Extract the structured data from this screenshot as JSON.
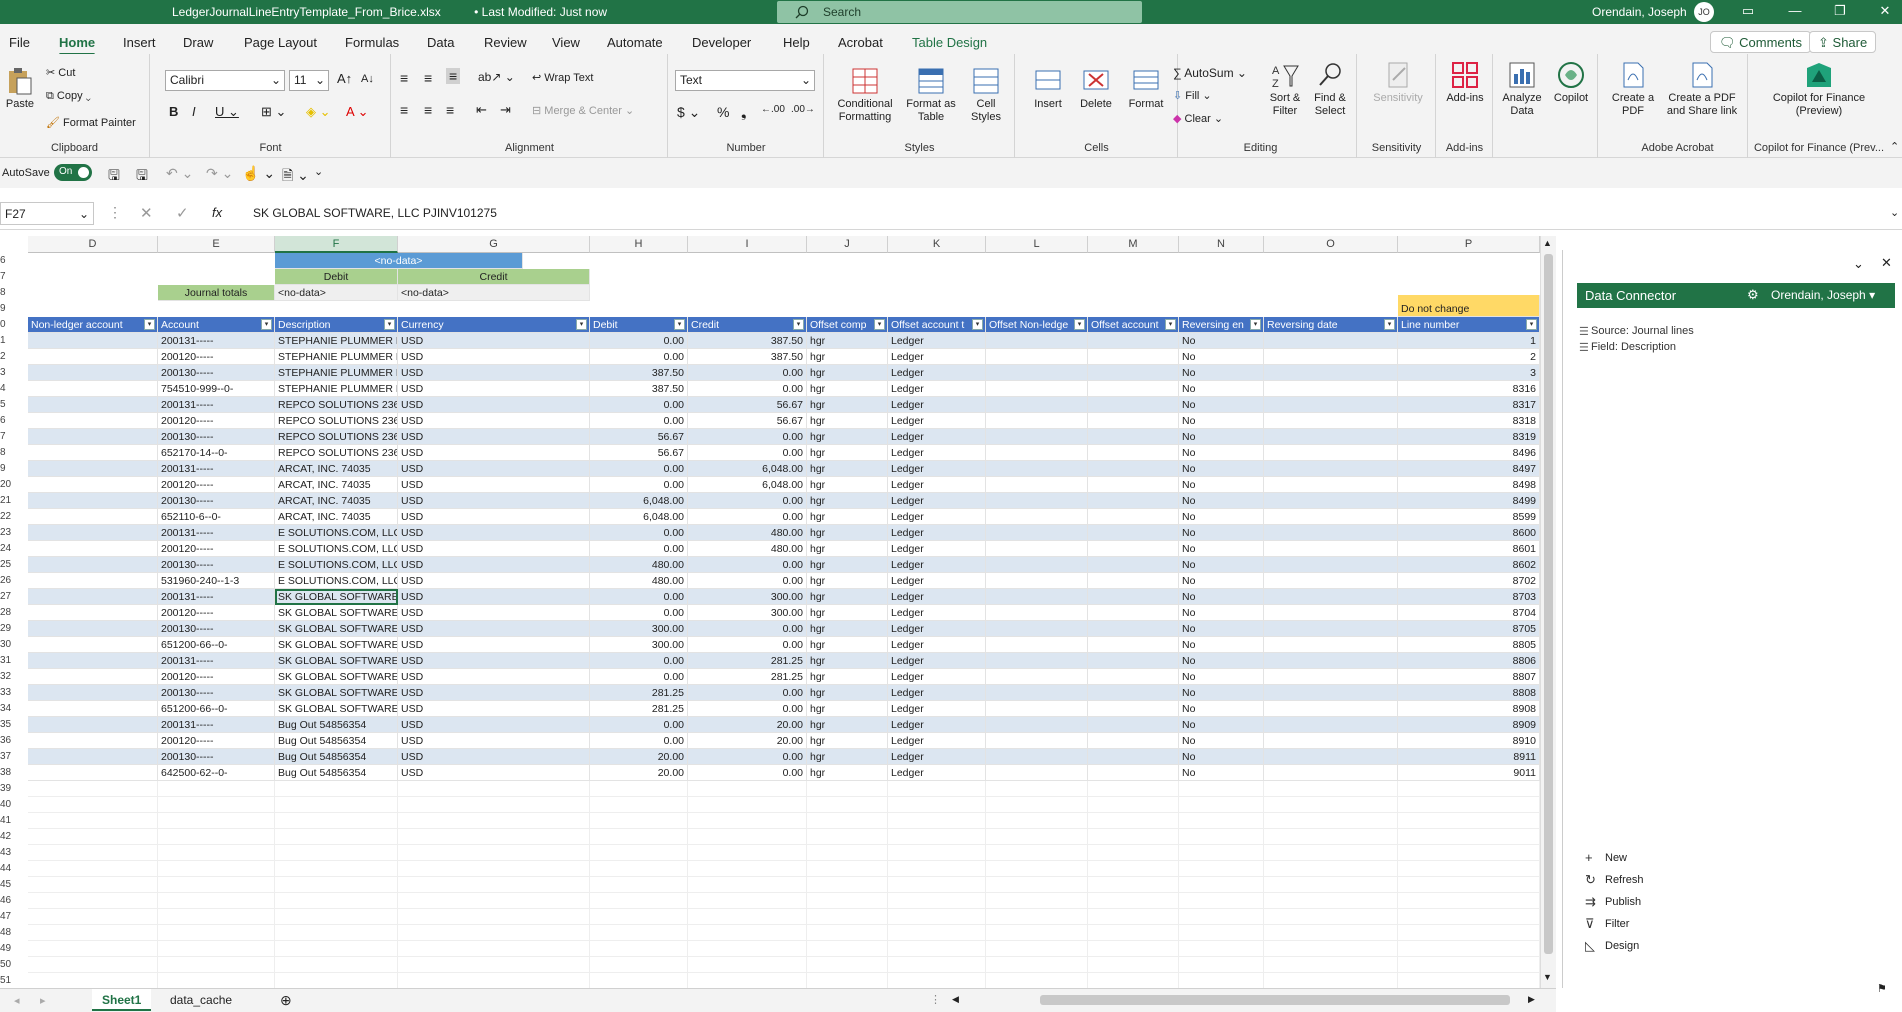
{
  "titlebar": {
    "filename": "LedgerJournalLineEntryTemplate_From_Brice.xlsx",
    "modified": "• Last Modified: Just now",
    "search_placeholder": "Search",
    "user": "Orendain, Joseph",
    "initials": "JO"
  },
  "menu": {
    "tabs": [
      "File",
      "Home",
      "Insert",
      "Draw",
      "Page Layout",
      "Formulas",
      "Data",
      "Review",
      "View",
      "Automate",
      "Developer",
      "Help",
      "Acrobat",
      "Table Design"
    ],
    "comments": "Comments",
    "share": "Share"
  },
  "ribbon": {
    "clipboard": {
      "label": "Clipboard",
      "paste": "Paste",
      "cut": "Cut",
      "copy": "Copy",
      "format_painter": "Format Painter"
    },
    "font": {
      "label": "Font",
      "font_name": "Calibri",
      "font_size": "11"
    },
    "alignment": {
      "label": "Alignment",
      "wrap": "Wrap Text",
      "merge": "Merge & Center"
    },
    "number": {
      "label": "Number",
      "format": "Text"
    },
    "styles": {
      "label": "Styles",
      "conditional": "Conditional Formatting",
      "format_table": "Format as Table",
      "cell_styles": "Cell Styles"
    },
    "cells": {
      "label": "Cells",
      "insert": "Insert",
      "delete": "Delete",
      "format": "Format"
    },
    "editing": {
      "label": "Editing",
      "autosum": "AutoSum",
      "fill": "Fill",
      "clear": "Clear",
      "sort": "Sort & Filter",
      "find": "Find & Select"
    },
    "sensitivity": {
      "label": "Sensitivity",
      "btn": "Sensitivity"
    },
    "addins": {
      "label": "Add-ins",
      "btn": "Add-ins"
    },
    "analyze": {
      "btn": "Analyze Data"
    },
    "copilot": {
      "btn": "Copilot"
    },
    "acrobat": {
      "label": "Adobe Acrobat",
      "create_pdf": "Create a PDF",
      "create_share": "Create a PDF and Share link"
    },
    "copilot_fin": {
      "label": "Copilot for Finance (Prev...",
      "btn": "Copilot for Finance (Preview)"
    }
  },
  "qat": {
    "autosave": "AutoSave",
    "toggle": "On"
  },
  "formula_bar": {
    "name_box": "F27",
    "fx": "fx",
    "formula": "SK GLOBAL SOFTWARE, LLC PJINV101275"
  },
  "columns": [
    "D",
    "E",
    "F",
    "G",
    "H",
    "I",
    "J",
    "K",
    "L",
    "M",
    "N",
    "O",
    "P"
  ],
  "top_rows": {
    "r6": "6",
    "r7": "7",
    "r8": "8",
    "r9": "9",
    "r10": "0",
    "nodata": "<no-data>",
    "debit": "Debit",
    "credit": "Credit",
    "journal_totals": "Journal totals",
    "nodata_debit": "<no-data>",
    "nodata_credit": "<no-data>",
    "do_not_change": "Do not change"
  },
  "table_headers": [
    "Non-ledger account",
    "Account",
    "Description",
    "Currency",
    "Debit",
    "Credit",
    "Offset comp",
    "Offset account t",
    "Offset Non-ledge",
    "Offset account",
    "Reversing en",
    "Reversing date",
    "Line number"
  ],
  "rows": [
    {
      "rn": "1",
      "account": "200131-----",
      "desc": "STEPHANIE PLUMMER E",
      "cur": "USD",
      "debit": "0.00",
      "credit": "387.50",
      "comp": "hgr",
      "type": "Ledger",
      "rev": "No",
      "line": "1"
    },
    {
      "rn": "2",
      "account": "200120-----",
      "desc": "STEPHANIE PLUMMER E",
      "cur": "USD",
      "debit": "0.00",
      "credit": "387.50",
      "comp": "hgr",
      "type": "Ledger",
      "rev": "No",
      "line": "2"
    },
    {
      "rn": "3",
      "account": "200130-----",
      "desc": "STEPHANIE PLUMMER E",
      "cur": "USD",
      "debit": "387.50",
      "credit": "0.00",
      "comp": "hgr",
      "type": "Ledger",
      "rev": "No",
      "line": "3"
    },
    {
      "rn": "4",
      "account": "754510-999--0-",
      "desc": "STEPHANIE PLUMMER E",
      "cur": "USD",
      "debit": "387.50",
      "credit": "0.00",
      "comp": "hgr",
      "type": "Ledger",
      "rev": "No",
      "line": "8316"
    },
    {
      "rn": "5",
      "account": "200131-----",
      "desc": "REPCO SOLUTIONS 2362",
      "cur": "USD",
      "debit": "0.00",
      "credit": "56.67",
      "comp": "hgr",
      "type": "Ledger",
      "rev": "No",
      "line": "8317"
    },
    {
      "rn": "6",
      "account": "200120-----",
      "desc": "REPCO SOLUTIONS 2362",
      "cur": "USD",
      "debit": "0.00",
      "credit": "56.67",
      "comp": "hgr",
      "type": "Ledger",
      "rev": "No",
      "line": "8318"
    },
    {
      "rn": "7",
      "account": "200130-----",
      "desc": "REPCO SOLUTIONS 2362",
      "cur": "USD",
      "debit": "56.67",
      "credit": "0.00",
      "comp": "hgr",
      "type": "Ledger",
      "rev": "No",
      "line": "8319"
    },
    {
      "rn": "8",
      "account": "652170-14--0-",
      "desc": "REPCO SOLUTIONS 2362",
      "cur": "USD",
      "debit": "56.67",
      "credit": "0.00",
      "comp": "hgr",
      "type": "Ledger",
      "rev": "No",
      "line": "8496"
    },
    {
      "rn": "9",
      "account": "200131-----",
      "desc": "ARCAT, INC. 74035",
      "cur": "USD",
      "debit": "0.00",
      "credit": "6,048.00",
      "comp": "hgr",
      "type": "Ledger",
      "rev": "No",
      "line": "8497"
    },
    {
      "rn": "20",
      "account": "200120-----",
      "desc": "ARCAT, INC. 74035",
      "cur": "USD",
      "debit": "0.00",
      "credit": "6,048.00",
      "comp": "hgr",
      "type": "Ledger",
      "rev": "No",
      "line": "8498"
    },
    {
      "rn": "21",
      "account": "200130-----",
      "desc": "ARCAT, INC. 74035",
      "cur": "USD",
      "debit": "6,048.00",
      "credit": "0.00",
      "comp": "hgr",
      "type": "Ledger",
      "rev": "No",
      "line": "8499"
    },
    {
      "rn": "22",
      "account": "652110-6--0-",
      "desc": "ARCAT, INC. 74035",
      "cur": "USD",
      "debit": "6,048.00",
      "credit": "0.00",
      "comp": "hgr",
      "type": "Ledger",
      "rev": "No",
      "line": "8599"
    },
    {
      "rn": "23",
      "account": "200131-----",
      "desc": "E SOLUTIONS.COM, LLC",
      "cur": "USD",
      "debit": "0.00",
      "credit": "480.00",
      "comp": "hgr",
      "type": "Ledger",
      "rev": "No",
      "line": "8600"
    },
    {
      "rn": "24",
      "account": "200120-----",
      "desc": "E SOLUTIONS.COM, LLC",
      "cur": "USD",
      "debit": "0.00",
      "credit": "480.00",
      "comp": "hgr",
      "type": "Ledger",
      "rev": "No",
      "line": "8601"
    },
    {
      "rn": "25",
      "account": "200130-----",
      "desc": "E SOLUTIONS.COM, LLC",
      "cur": "USD",
      "debit": "480.00",
      "credit": "0.00",
      "comp": "hgr",
      "type": "Ledger",
      "rev": "No",
      "line": "8602"
    },
    {
      "rn": "26",
      "account": "531960-240--1-3",
      "desc": "E SOLUTIONS.COM, LLC",
      "cur": "USD",
      "debit": "480.00",
      "credit": "0.00",
      "comp": "hgr",
      "type": "Ledger",
      "rev": "No",
      "line": "8702"
    },
    {
      "rn": "27",
      "account": "200131-----",
      "desc": "SK GLOBAL SOFTWARE,",
      "cur": "USD",
      "debit": "0.00",
      "credit": "300.00",
      "comp": "hgr",
      "type": "Ledger",
      "rev": "No",
      "line": "8703"
    },
    {
      "rn": "28",
      "account": "200120-----",
      "desc": "SK GLOBAL SOFTWARE,",
      "cur": "USD",
      "debit": "0.00",
      "credit": "300.00",
      "comp": "hgr",
      "type": "Ledger",
      "rev": "No",
      "line": "8704"
    },
    {
      "rn": "29",
      "account": "200130-----",
      "desc": "SK GLOBAL SOFTWARE,",
      "cur": "USD",
      "debit": "300.00",
      "credit": "0.00",
      "comp": "hgr",
      "type": "Ledger",
      "rev": "No",
      "line": "8705"
    },
    {
      "rn": "30",
      "account": "651200-66--0-",
      "desc": "SK GLOBAL SOFTWARE,",
      "cur": "USD",
      "debit": "300.00",
      "credit": "0.00",
      "comp": "hgr",
      "type": "Ledger",
      "rev": "No",
      "line": "8805"
    },
    {
      "rn": "31",
      "account": "200131-----",
      "desc": "SK GLOBAL SOFTWARE,",
      "cur": "USD",
      "debit": "0.00",
      "credit": "281.25",
      "comp": "hgr",
      "type": "Ledger",
      "rev": "No",
      "line": "8806"
    },
    {
      "rn": "32",
      "account": "200120-----",
      "desc": "SK GLOBAL SOFTWARE,",
      "cur": "USD",
      "debit": "0.00",
      "credit": "281.25",
      "comp": "hgr",
      "type": "Ledger",
      "rev": "No",
      "line": "8807"
    },
    {
      "rn": "33",
      "account": "200130-----",
      "desc": "SK GLOBAL SOFTWARE,",
      "cur": "USD",
      "debit": "281.25",
      "credit": "0.00",
      "comp": "hgr",
      "type": "Ledger",
      "rev": "No",
      "line": "8808"
    },
    {
      "rn": "34",
      "account": "651200-66--0-",
      "desc": "SK GLOBAL SOFTWARE,",
      "cur": "USD",
      "debit": "281.25",
      "credit": "0.00",
      "comp": "hgr",
      "type": "Ledger",
      "rev": "No",
      "line": "8908"
    },
    {
      "rn": "35",
      "account": "200131-----",
      "desc": "Bug Out 54856354",
      "cur": "USD",
      "debit": "0.00",
      "credit": "20.00",
      "comp": "hgr",
      "type": "Ledger",
      "rev": "No",
      "line": "8909"
    },
    {
      "rn": "36",
      "account": "200120-----",
      "desc": "Bug Out 54856354",
      "cur": "USD",
      "debit": "0.00",
      "credit": "20.00",
      "comp": "hgr",
      "type": "Ledger",
      "rev": "No",
      "line": "8910"
    },
    {
      "rn": "37",
      "account": "200130-----",
      "desc": "Bug Out 54856354",
      "cur": "USD",
      "debit": "20.00",
      "credit": "0.00",
      "comp": "hgr",
      "type": "Ledger",
      "rev": "No",
      "line": "8911"
    },
    {
      "rn": "38",
      "account": "642500-62--0-",
      "desc": "Bug Out 54856354",
      "cur": "USD",
      "debit": "20.00",
      "credit": "0.00",
      "comp": "hgr",
      "type": "Ledger",
      "rev": "No",
      "line": "9011"
    }
  ],
  "empty_rows": [
    "39",
    "40",
    "41",
    "42",
    "43",
    "44",
    "45",
    "46",
    "47",
    "48",
    "49",
    "50",
    "51"
  ],
  "sheets": [
    "Sheet1",
    "data_cache"
  ],
  "pane": {
    "title": "Data Connector",
    "user": "Orendain, Joseph",
    "source": "Source: Journal lines",
    "field": "Field: Description",
    "actions": [
      "New",
      "Refresh",
      "Publish",
      "Filter",
      "Design"
    ]
  },
  "colors": {
    "brand": "#217346",
    "table_header": "#4472c4",
    "band": "#dce6f1",
    "green_hdr": "#a9d08e",
    "yellow": "#ffd966",
    "blue_hdr": "#5b9bd5"
  }
}
